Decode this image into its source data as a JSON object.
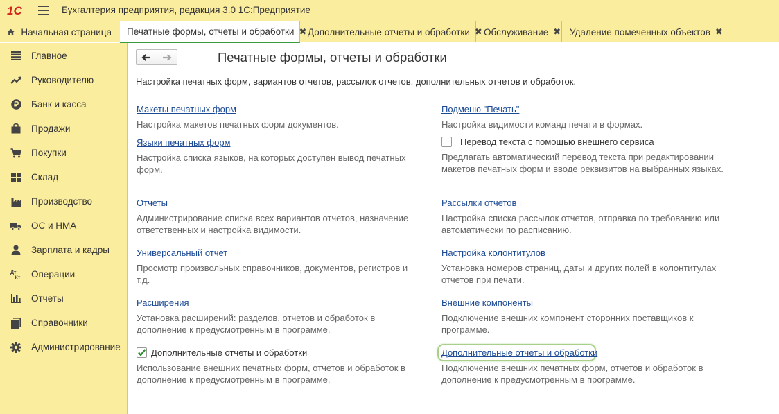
{
  "app": {
    "title": "Бухгалтерия предприятия, редакция 3.0 1С:Предприятие",
    "logo_text": "1С"
  },
  "tabs": [
    {
      "label": "Начальная страница",
      "closable": false
    },
    {
      "label": "Печатные формы, отчеты и обработки",
      "closable": true,
      "active": true
    },
    {
      "label": "Дополнительные отчеты и обработки",
      "closable": true
    },
    {
      "label": "Обслуживание",
      "closable": true
    },
    {
      "label": "Удаление помеченных объектов",
      "closable": true
    }
  ],
  "tab_close_glyph": "✖",
  "sidebar": {
    "items": [
      {
        "label": "Главное",
        "icon": "list-icon"
      },
      {
        "label": "Руководителю",
        "icon": "trend-up-icon"
      },
      {
        "label": "Банк и касса",
        "icon": "ruble-coin-icon"
      },
      {
        "label": "Продажи",
        "icon": "shopping-bag-icon"
      },
      {
        "label": "Покупки",
        "icon": "cart-icon"
      },
      {
        "label": "Склад",
        "icon": "warehouse-grid-icon"
      },
      {
        "label": "Производство",
        "icon": "factory-icon"
      },
      {
        "label": "ОС и НМА",
        "icon": "truck-icon"
      },
      {
        "label": "Зарплата и кадры",
        "icon": "person-icon"
      },
      {
        "label": "Операции",
        "icon": "debit-credit-icon"
      },
      {
        "label": "Отчеты",
        "icon": "bar-chart-icon"
      },
      {
        "label": "Справочники",
        "icon": "books-icon"
      },
      {
        "label": "Администрирование",
        "icon": "gear-icon"
      }
    ],
    "icon_text": {
      "dt": "Дт",
      "kt": "Кт"
    }
  },
  "page": {
    "title": "Печатные формы, отчеты и обработки",
    "description": "Настройка печатных форм, вариантов отчетов, рассылок отчетов, дополнительных отчетов и обработок.",
    "left": [
      {
        "link": "Макеты печатных форм",
        "desc": "Настройка макетов печатных форм документов."
      },
      {
        "link": "Языки печатных форм",
        "desc": "Настройка списка языков, на которых доступен вывод печатных форм."
      },
      {
        "link": "Отчеты",
        "desc": "Администрирование списка всех вариантов отчетов, назначение ответственных и настройка видимости."
      },
      {
        "link": "Универсальный отчет",
        "desc": "Просмотр произвольных справочников, документов, регистров и т.д."
      },
      {
        "link": "Расширения",
        "desc": "Установка расширений: разделов, отчетов и обработок в дополнение к предусмотренным в программе."
      }
    ],
    "left_checkbox": {
      "label": "Дополнительные отчеты и обработки",
      "checked": true,
      "desc": "Использование внешних печатных форм, отчетов и обработок в дополнение к предусмотренным в программе."
    },
    "right": [
      {
        "link": "Подменю \"Печать\"",
        "desc": "Настройка видимости команд печати в формах."
      },
      {
        "link": "Рассылки отчетов",
        "desc": "Настройка списка рассылок отчетов, отправка по требованию или автоматически по расписанию."
      },
      {
        "link": "Настройка колонтитулов",
        "desc": "Установка номеров страниц, даты и других полей в колонтитулах отчетов при печати."
      },
      {
        "link": "Внешние компоненты",
        "desc": "Подключение внешних компонент сторонних поставщиков к программе."
      },
      {
        "link": "Дополнительные отчеты и обработки",
        "desc": "Подключение внешних печатных форм, отчетов и обработок в дополнение к предусмотренным в программе.",
        "focused": true
      }
    ],
    "right_checkbox": {
      "label": "Перевод текста с помощью внешнего сервиса",
      "checked": false,
      "desc": "Предлагать автоматический перевод текста при редактировании макетов печатных форм и вводе реквизитов на выбранных языках."
    }
  },
  "colors": {
    "panel": "#fbed9e",
    "link": "#1c4a95",
    "accent": "#3a9b3a",
    "checkmark": "#2f8f2f"
  }
}
